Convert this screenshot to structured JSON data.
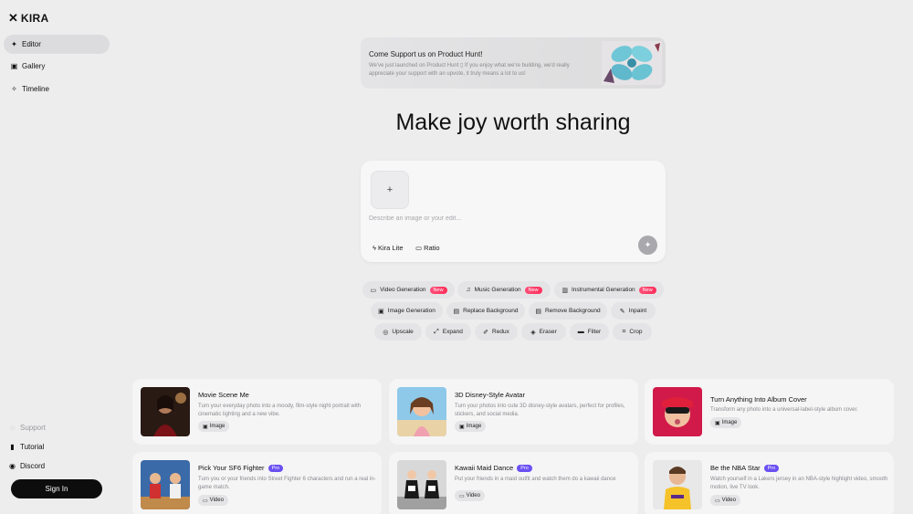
{
  "app": {
    "logo_mark": "✕",
    "logo_text": "KIRA"
  },
  "sidebar": {
    "items": [
      {
        "label": "Editor",
        "icon": "sparkle-icon"
      },
      {
        "label": "Gallery",
        "icon": "gallery-icon"
      },
      {
        "label": "Timeline",
        "icon": "timeline-icon"
      }
    ],
    "bottom": [
      {
        "label": "Support",
        "icon": "support-icon"
      },
      {
        "label": "Tutorial",
        "icon": "book-icon"
      },
      {
        "label": "Discord",
        "icon": "discord-icon"
      }
    ],
    "signin_label": "Sign In"
  },
  "banner": {
    "title": "Come Support us on Product Hunt!",
    "text": "We've just launched on Product Hunt ▯ If you enjoy what we're building, we'd really appreciate your support with an upvote, it truly means a lot to us!"
  },
  "headline": "Make joy worth sharing",
  "composer": {
    "upload_icon": "+",
    "placeholder": "Describe an image or your edit...",
    "model_label": "Kira Lite",
    "ratio_label": "Ratio",
    "send_icon": "✦"
  },
  "chips": [
    {
      "label": "Video Generation",
      "badge": "New",
      "icon": "video-icon"
    },
    {
      "label": "Music Generation",
      "badge": "New",
      "icon": "music-icon"
    },
    {
      "label": "Instrumental Generation",
      "badge": "New",
      "icon": "instrument-icon"
    },
    {
      "label": "Image Generation",
      "icon": "image-icon"
    },
    {
      "label": "Replace Background",
      "icon": "replace-bg-icon"
    },
    {
      "label": "Remove Background",
      "icon": "remove-bg-icon"
    },
    {
      "label": "Inpaint",
      "icon": "inpaint-icon"
    },
    {
      "label": "Upscale",
      "icon": "upscale-icon"
    },
    {
      "label": "Expand",
      "icon": "expand-icon"
    },
    {
      "label": "Redux",
      "icon": "redux-icon"
    },
    {
      "label": "Eraser",
      "icon": "eraser-icon"
    },
    {
      "label": "Filter",
      "icon": "filter-icon"
    },
    {
      "label": "Crop",
      "icon": "crop-icon"
    }
  ],
  "cards": [
    {
      "title": "Movie Scene Me",
      "desc": "Turn your everyday photo into a moody, film-style night portrait with cinematic lighting and a new vibe.",
      "tag": "Image"
    },
    {
      "title": "3D Disney-Style Avatar",
      "desc": "Turn your photos into cute 3D disney-style avatars, perfect for profiles, stickers, and social media.",
      "tag": "Image"
    },
    {
      "title": "Turn Anything Into Album Cover",
      "desc": "Transform any photo into a universal-label-style album cover.",
      "tag": "Image"
    },
    {
      "title": "Pick Your SF6 Fighter",
      "badge": "Pro",
      "desc": "Turn you or your friends into Street Fighter 6 characters and run a real in-game match.",
      "tag": "Video"
    },
    {
      "title": "Kawaii Maid Dance",
      "badge": "Pro",
      "desc": "Put your friends in a maid outfit and watch them do a kawaii dance",
      "tag": "Video"
    },
    {
      "title": "Be the NBA Star",
      "badge": "Pro",
      "desc": "Watch yourself in a Lakers jersey in an NBA-style highlight video, smooth motion, live TV look.",
      "tag": "Video"
    }
  ]
}
